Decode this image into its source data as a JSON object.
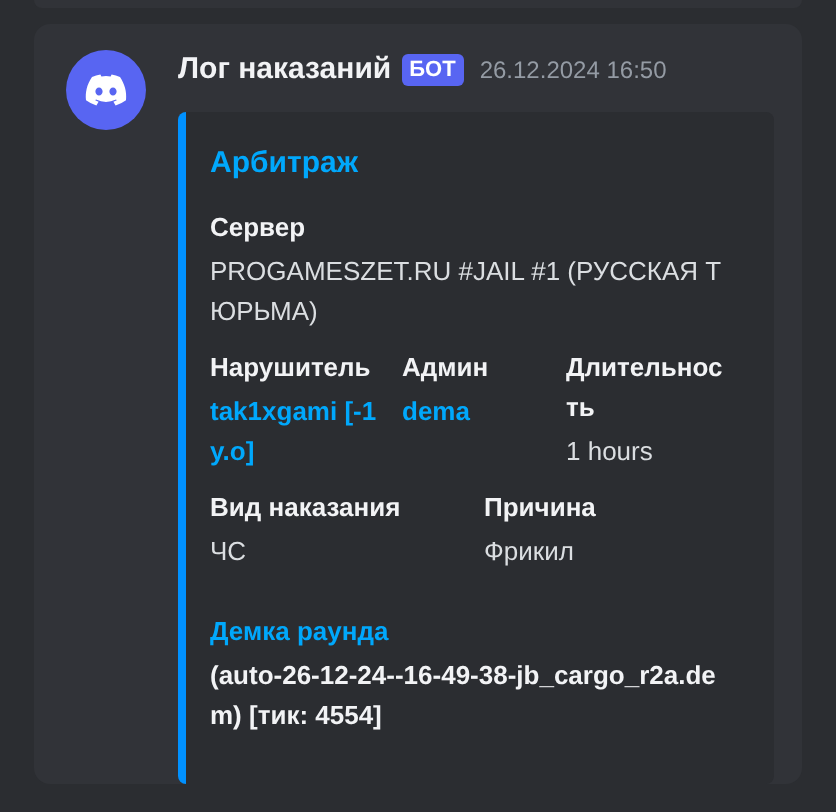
{
  "message": {
    "author": "Лог наказаний",
    "badge": "БОТ",
    "timestamp": "26.12.2024 16:50"
  },
  "embed": {
    "title": "Арбитраж",
    "field_rows": [
      [
        {
          "kind": "plain",
          "name": "Сервер",
          "value": "PROGAMESZET.RU #JAIL #1 (РУССКАЯ ТЮРЬМА)"
        }
      ],
      [
        {
          "kind": "mention",
          "name": "Нарушитель",
          "value": "tak1xgami [-1 y.o]"
        },
        {
          "kind": "mention",
          "name": "Админ",
          "value": "dema"
        },
        {
          "kind": "plain",
          "name": "Длительность",
          "value": "1 hours"
        }
      ],
      [
        {
          "kind": "plain",
          "name": "Вид наказания",
          "value": "ЧС"
        },
        {
          "kind": "plain",
          "name": "Причина",
          "value": "Фрикил"
        }
      ],
      [
        {
          "kind": "highlight",
          "name": "Демка раунда",
          "value": "(auto-26-12-24--16-49-38-jb_cargo_r2a.dem) [тик: 4554]"
        }
      ]
    ]
  }
}
